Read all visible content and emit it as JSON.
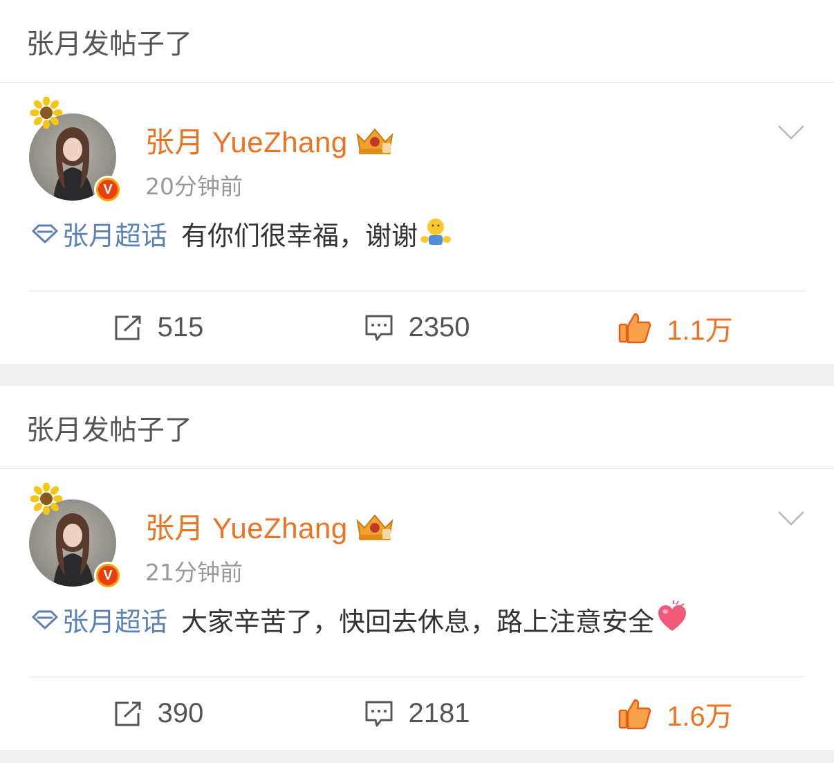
{
  "posts": [
    {
      "header": "张月发帖子了",
      "author": "张月 YueZhang",
      "time": "20分钟前",
      "topic": "张月超话",
      "text": "有你们很幸福，谢谢",
      "emoji": "hug-emoji",
      "repost_count": "515",
      "comment_count": "2350",
      "like_count": "1.1万"
    },
    {
      "header": "张月发帖子了",
      "author": "张月 YueZhang",
      "time": "21分钟前",
      "topic": "张月超话",
      "text": "大家辛苦了，快回去休息，路上注意安全",
      "emoji": "heart-emoji",
      "repost_count": "390",
      "comment_count": "2181",
      "like_count": "1.6万"
    }
  ],
  "colors": {
    "name_orange": "#ec7321",
    "topic_blue": "#5b80b3",
    "muted_gray": "#999999",
    "like_orange": "#ec7321"
  }
}
